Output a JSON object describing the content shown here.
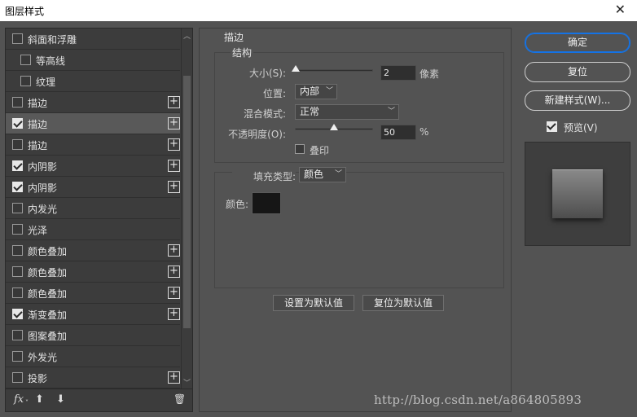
{
  "window": {
    "title": "图层样式",
    "close_glyph": "✕"
  },
  "styles_list": [
    {
      "label": "斜面和浮雕",
      "checked": false,
      "plus": false,
      "indent": false,
      "selected": false
    },
    {
      "label": "等高线",
      "checked": false,
      "plus": false,
      "indent": true,
      "selected": false
    },
    {
      "label": "纹理",
      "checked": false,
      "plus": false,
      "indent": true,
      "selected": false
    },
    {
      "label": "描边",
      "checked": false,
      "plus": true,
      "indent": false,
      "selected": false
    },
    {
      "label": "描边",
      "checked": true,
      "plus": true,
      "indent": false,
      "selected": true
    },
    {
      "label": "描边",
      "checked": false,
      "plus": true,
      "indent": false,
      "selected": false
    },
    {
      "label": "内阴影",
      "checked": true,
      "plus": true,
      "indent": false,
      "selected": false
    },
    {
      "label": "内阴影",
      "checked": true,
      "plus": true,
      "indent": false,
      "selected": false
    },
    {
      "label": "内发光",
      "checked": false,
      "plus": false,
      "indent": false,
      "selected": false
    },
    {
      "label": "光泽",
      "checked": false,
      "plus": false,
      "indent": false,
      "selected": false
    },
    {
      "label": "颜色叠加",
      "checked": false,
      "plus": true,
      "indent": false,
      "selected": false
    },
    {
      "label": "颜色叠加",
      "checked": false,
      "plus": true,
      "indent": false,
      "selected": false
    },
    {
      "label": "颜色叠加",
      "checked": false,
      "plus": true,
      "indent": false,
      "selected": false
    },
    {
      "label": "渐变叠加",
      "checked": true,
      "plus": true,
      "indent": false,
      "selected": false
    },
    {
      "label": "图案叠加",
      "checked": false,
      "plus": false,
      "indent": false,
      "selected": false
    },
    {
      "label": "外发光",
      "checked": false,
      "plus": false,
      "indent": false,
      "selected": false
    },
    {
      "label": "投影",
      "checked": false,
      "plus": true,
      "indent": false,
      "selected": false
    }
  ],
  "plus_glyph": "+",
  "scroll": {
    "up": "︿",
    "down": "﹀"
  },
  "footer": {
    "fx": "fx",
    "fx_sub": "˅",
    "up": "⬆",
    "down": "⬇",
    "trash": "🗑"
  },
  "stroke": {
    "section_title": "描边",
    "structure_title": "结构",
    "size_label": "大小(S):",
    "size_value": "2",
    "size_unit": "像素",
    "position_label": "位置:",
    "position_value": "内部",
    "blend_label": "混合模式:",
    "blend_value": "正常",
    "opacity_label": "不透明度(O):",
    "opacity_value": "50",
    "opacity_unit": "%",
    "overprint_label": "叠印",
    "fill_type_label": "填充类型:",
    "fill_type_value": "颜色",
    "color_label": "颜色:",
    "color_value": "#161616",
    "size_fraction": 0.0,
    "opacity_fraction": 0.5
  },
  "buttons": {
    "set_default": "设置为默认值",
    "reset_default": "复位为默认值",
    "ok": "确定",
    "reset": "复位",
    "new_style": "新建样式(W)...",
    "preview": "预览(V)"
  },
  "colors": {
    "accent": "#1473e6",
    "panel": "#535353",
    "list_bg": "#3c3c3c"
  },
  "watermark": "http://blog.csdn.net/a864805893"
}
